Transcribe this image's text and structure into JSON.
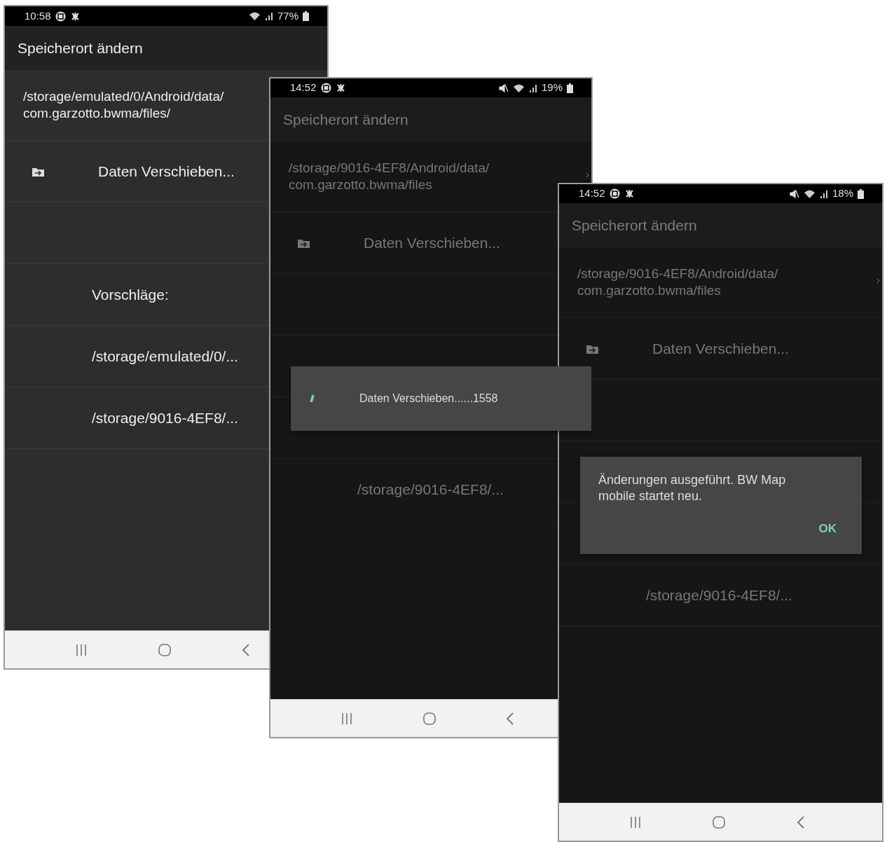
{
  "screens": [
    {
      "dimmed": false,
      "status_bar": {
        "time": "10:58",
        "muted": false,
        "battery": "77%"
      },
      "title": "Speicherort ändern",
      "rows": [
        {
          "kind": "path",
          "text": "/storage/emulated/0/Android/data/\ncom.garzotto.bwma/files/",
          "chevron": false
        },
        {
          "kind": "action",
          "text": "Daten Verschieben..."
        },
        {
          "kind": "blank"
        },
        {
          "kind": "heading",
          "text": "Vorschläge:"
        },
        {
          "kind": "option",
          "text": "/storage/emulated/0/..."
        },
        {
          "kind": "option",
          "text": "/storage/9016-4EF8/..."
        }
      ]
    },
    {
      "dimmed": true,
      "status_bar": {
        "time": "14:52",
        "muted": true,
        "battery": "19%"
      },
      "title": "Speicherort ändern",
      "rows": [
        {
          "kind": "path",
          "text": "/storage/9016-4EF8/Android/data/\ncom.garzotto.bwma/files",
          "chevron": true
        },
        {
          "kind": "action",
          "text": "Daten Verschieben..."
        },
        {
          "kind": "blank"
        },
        {
          "kind": "covered"
        },
        {
          "kind": "covered"
        },
        {
          "kind": "option",
          "text": "/storage/9016-4EF8/..."
        }
      ],
      "dialog": {
        "kind": "progress",
        "text": "Daten Verschieben......1558"
      }
    },
    {
      "dimmed": true,
      "status_bar": {
        "time": "14:52",
        "muted": true,
        "battery": "18%"
      },
      "title": "Speicherort ändern",
      "rows": [
        {
          "kind": "path",
          "text": "/storage/9016-4EF8/Android/data/\ncom.garzotto.bwma/files",
          "chevron": true
        },
        {
          "kind": "action",
          "text": "Daten Verschieben..."
        },
        {
          "kind": "blank"
        },
        {
          "kind": "covered"
        },
        {
          "kind": "covered"
        },
        {
          "kind": "option",
          "text": "/storage/9016-4EF8/..."
        }
      ],
      "dialog": {
        "kind": "alert",
        "text": "Änderungen ausgeführt. BW Map\nmobile startet neu.",
        "button": "OK"
      }
    }
  ]
}
